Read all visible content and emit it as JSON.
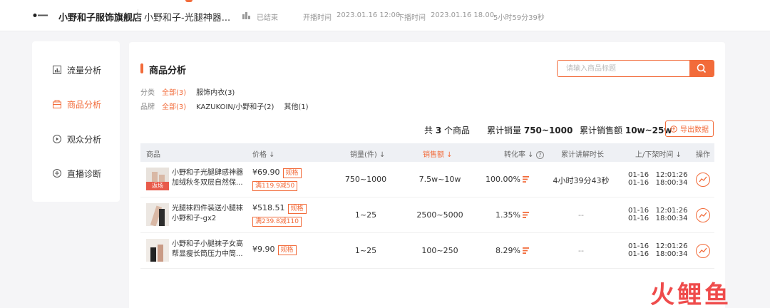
{
  "header": {
    "store_name": "小野和子服饰旗舰店",
    "live_title": "小野和子-光腿神器...",
    "status": "已结束",
    "start_label": "开播时间",
    "start_time": "2023.01.16 12:00",
    "end_label": "下播时间",
    "end_time": "2023.01.16 18.00",
    "duration": "5小时59分39秒"
  },
  "sidebar": {
    "items": [
      {
        "label": "流量分析",
        "icon": "chart-icon",
        "active": false
      },
      {
        "label": "商品分析",
        "icon": "goods-icon",
        "active": true
      },
      {
        "label": "观众分析",
        "icon": "play-icon",
        "active": false
      },
      {
        "label": "直播诊断",
        "icon": "diagnose-icon",
        "active": false
      }
    ]
  },
  "main": {
    "title": "商品分析",
    "search_placeholder": "请输入商品标题",
    "category_label": "分类",
    "categories": [
      "全部(3)",
      "服饰内衣(3)"
    ],
    "brand_label": "品牌",
    "brands": [
      "全部(3)",
      "KAZUKOIN/小野和子(2)",
      "其他(1)"
    ],
    "summary": {
      "count_prefix": "共",
      "count": "3",
      "count_suffix": "个商品",
      "sales_label": "累计销量",
      "sales": "750~1000",
      "amount_label": "累计销售额",
      "amount": "10w~25w"
    },
    "export_label": "导出数据",
    "columns": {
      "product": "商品",
      "price": "价格",
      "volume": "销量(件)",
      "amount": "销售额",
      "conversion": "转化率",
      "explain": "累计讲解时长",
      "shelf_time": "上/下架时间",
      "action": "操作"
    },
    "rows": [
      {
        "name": "小野和子光腿肆感神器加绒秋冬双层自然保...",
        "tag": "返场",
        "price": "¥69.90",
        "spec": "规格",
        "promo": "满119.9减50",
        "volume": "750~1000",
        "amount": "7.5w~10w",
        "conversion": "100.00%",
        "explain": "4小时39分43秒",
        "times": "01-16   12:01:26\n01-16   18:00:34"
      },
      {
        "name": "光腿袜四件装送小腿袜小野和子-gx2",
        "tag": "",
        "price": "¥518.51",
        "spec": "规格",
        "promo": "满239.8减110",
        "volume": "1~25",
        "amount": "2500~5000",
        "conversion": "1.35%",
        "explain": "--",
        "times": "01-16   12:01:26\n01-16   18:00:34"
      },
      {
        "name": "小野和子小腿袜子女高帮显瘦长筒压力中筒...",
        "tag": "",
        "price": "¥9.90",
        "spec": "规格",
        "promo": "",
        "volume": "1~25",
        "amount": "100~250",
        "conversion": "8.29%",
        "explain": "--",
        "times": "01-16   12:01:26\n01-16   18:00:34"
      }
    ]
  },
  "watermark": "火鲤鱼",
  "colors": {
    "accent": "#f26b3a",
    "background": "#f5f5f7"
  }
}
